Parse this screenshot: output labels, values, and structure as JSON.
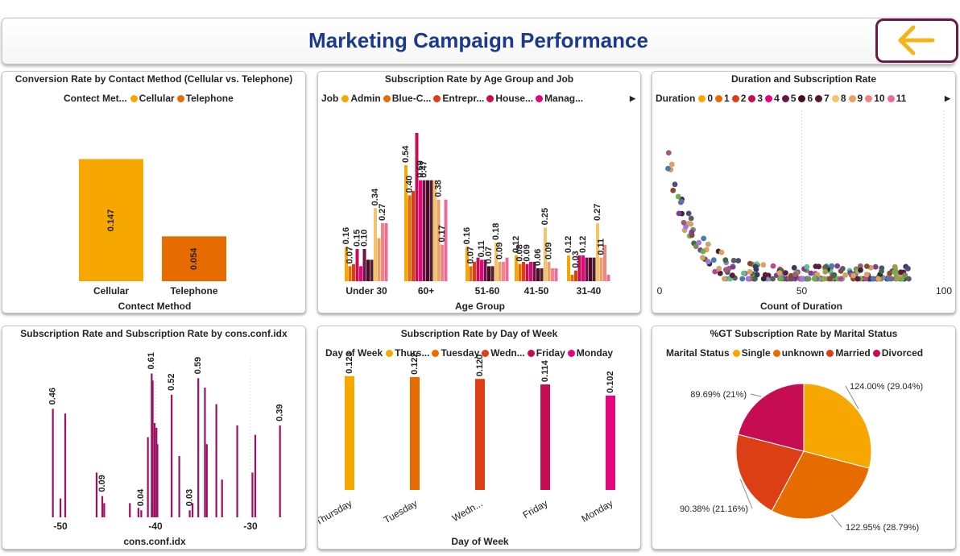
{
  "header": {
    "title": "Marketing Campaign Performance",
    "back_icon": "arrow-left-icon",
    "back_color": "#f4b41a"
  },
  "colors": {
    "palette": [
      "#f7a800",
      "#e66c00",
      "#dd3f14",
      "#c70d52",
      "#e3077e",
      "#6e1444",
      "#4b0a26",
      "#521f2e",
      "#f5c46a",
      "#e9a062",
      "#f28484",
      "#ea6b9c"
    ]
  },
  "panels": [
    {
      "key": "conv",
      "title": "Conversion Rate by Contact Method (Cellular vs. Telephone)",
      "legend": {
        "title": "Contect Met...",
        "items": [
          "Cellular",
          "Telephone"
        ]
      },
      "chart_data": {
        "type": "bar",
        "categories": [
          "Cellular",
          "Telephone"
        ],
        "values": [
          0.147,
          0.054
        ],
        "labels": [
          "0.147",
          "0.054"
        ],
        "xlabel": "Contect Method",
        "ylabel": "",
        "ylim": [
          0,
          0.16
        ]
      }
    },
    {
      "key": "agejob",
      "title": "Subscription Rate by Age Group and Job",
      "legend": {
        "title": "Job",
        "items": [
          "Admin",
          "Blue-C...",
          "Entrepr...",
          "House...",
          "Manag..."
        ]
      },
      "chart_data": {
        "type": "bar",
        "categories": [
          "Under 30",
          "60+",
          "51-60",
          "41-50",
          "31-40"
        ],
        "series": [
          {
            "name": "Admin",
            "values": [
              0.16,
              0.54,
              0.16,
              0.12,
              0.12
            ]
          },
          {
            "name": "Blue-C...",
            "values": [
              0.07,
              0.4,
              0.07,
              0.08,
              0.03
            ]
          },
          {
            "name": "Entrepr...",
            "values": [
              0.08,
              0.42,
              0.09,
              0.09,
              0.05
            ]
          },
          {
            "name": "House...",
            "values": [
              0.15,
              0.69,
              0.11,
              0.08,
              0.12
            ]
          },
          {
            "name": "Manag...",
            "values": [
              0.07,
              0.47,
              0.1,
              0.09,
              0.12
            ]
          },
          {
            "values": [
              0.15,
              0.47,
              0.1,
              0.09,
              0.11
            ]
          },
          {
            "values": [
              0.1,
              0.47,
              0.07,
              0.06,
              0.11
            ]
          },
          {
            "values": [
              0.1,
              0.47,
              0.07,
              0.06,
              0.11
            ]
          },
          {
            "values": [
              0.34,
              0.47,
              0.18,
              0.25,
              0.27
            ]
          },
          {
            "values": [
              0.2,
              0.38,
              0.09,
              0.09,
              0.11
            ]
          },
          {
            "values": [
              0.27,
              0.17,
              0.09,
              0.06,
              0.17
            ]
          },
          {
            "values": [
              0.27,
              0.38,
              0.11,
              0.06,
              0.03
            ]
          }
        ],
        "labels": [
          {
            "g": 0,
            "s": 0,
            "t": "0.16"
          },
          {
            "g": 0,
            "s": 1,
            "t": "0.07"
          },
          {
            "g": 0,
            "s": 3,
            "t": "0.15"
          },
          {
            "g": 0,
            "s": 5,
            "t": "0.10"
          },
          {
            "g": 0,
            "s": 8,
            "t": "0.34"
          },
          {
            "g": 0,
            "s": 10,
            "t": "0.27"
          },
          {
            "g": 1,
            "s": 0,
            "t": "0.54"
          },
          {
            "g": 1,
            "s": 1,
            "t": "0.40"
          },
          {
            "g": 1,
            "s": 4,
            "t": "0.69"
          },
          {
            "g": 1,
            "s": 5,
            "t": "0.47"
          },
          {
            "g": 1,
            "s": 9,
            "t": "0.38"
          },
          {
            "g": 1,
            "s": 10,
            "t": "0.17"
          },
          {
            "g": 2,
            "s": 0,
            "t": "0.16"
          },
          {
            "g": 2,
            "s": 1,
            "t": "0.07"
          },
          {
            "g": 2,
            "s": 4,
            "t": "0.11"
          },
          {
            "g": 2,
            "s": 6,
            "t": "0.07"
          },
          {
            "g": 2,
            "s": 8,
            "t": "0.18"
          },
          {
            "g": 2,
            "s": 9,
            "t": "0.09"
          },
          {
            "g": 3,
            "s": 0,
            "t": "0.12"
          },
          {
            "g": 3,
            "s": 1,
            "t": "0.08"
          },
          {
            "g": 3,
            "s": 3,
            "t": "0.09"
          },
          {
            "g": 3,
            "s": 6,
            "t": "0.06"
          },
          {
            "g": 3,
            "s": 8,
            "t": "0.25"
          },
          {
            "g": 3,
            "s": 9,
            "t": "0.09"
          },
          {
            "g": 4,
            "s": 0,
            "t": "0.12"
          },
          {
            "g": 4,
            "s": 2,
            "t": "0.03"
          },
          {
            "g": 4,
            "s": 4,
            "t": "0.12"
          },
          {
            "g": 4,
            "s": 8,
            "t": "0.27"
          },
          {
            "g": 4,
            "s": 9,
            "t": "0.11"
          }
        ],
        "xlabel": "Age Group",
        "ylabel": "",
        "ylim": [
          0,
          0.75
        ]
      }
    },
    {
      "key": "dur",
      "title": "Duration and Subscription Rate",
      "legend": {
        "title": "Duration",
        "items": [
          "0",
          "1",
          "2",
          "3",
          "4",
          "5",
          "6",
          "7",
          "8",
          "9",
          "10",
          "11"
        ]
      },
      "chart_data": {
        "type": "scatter",
        "xlabel": "Count of Duration",
        "ylabel": "",
        "xlim": [
          0,
          100
        ],
        "xticks": [
          "0",
          "50",
          "100"
        ]
      }
    },
    {
      "key": "cons",
      "title": "Subscription Rate and Subscription Rate by cons.conf.idx",
      "chart_data": {
        "type": "bar",
        "x": [
          -50.8,
          -50.0,
          -49.5,
          -46.2,
          -45.6,
          -45.4,
          -42.7,
          -41.8,
          -41.5,
          -40.8,
          -40.4,
          -40.3,
          -40.1,
          -39.9,
          -39.8,
          -38.3,
          -37.5,
          -36.4,
          -36.1,
          -35.5,
          -34.8,
          -34.6,
          -33.6,
          -33.0,
          -31.4,
          -29.8,
          -29.5,
          -26.9
        ],
        "values": [
          0.46,
          0.08,
          0.44,
          0.19,
          0.09,
          0.06,
          0.06,
          0.04,
          0.03,
          0.34,
          0.61,
          0.58,
          0.4,
          0.38,
          0.31,
          0.52,
          0.26,
          0.03,
          0.06,
          0.59,
          0.55,
          0.31,
          0.48,
          0.16,
          0.39,
          0.19,
          0.35,
          0.39
        ],
        "labels": [
          {
            "i": 0,
            "t": "0.46"
          },
          {
            "i": 4,
            "t": "0.09"
          },
          {
            "i": 8,
            "t": "0.04"
          },
          {
            "i": 10,
            "t": "0.61"
          },
          {
            "i": 15,
            "t": "0.52"
          },
          {
            "i": 17,
            "t": "0.03"
          },
          {
            "i": 19,
            "t": "0.59"
          },
          {
            "i": 27,
            "t": "0.39"
          }
        ],
        "color": "#9b1063",
        "xlabel": "cons.conf.idx",
        "ylabel": "",
        "xticks": [
          "-50",
          "-40",
          "-30"
        ],
        "ylim": [
          0,
          0.68
        ]
      }
    },
    {
      "key": "dow",
      "title": "Subscription Rate by Day of Week",
      "legend": {
        "title": "Day of Week",
        "items": [
          "Thurs...",
          "Tuesday",
          "Wedn...",
          "Friday",
          "Monday"
        ]
      },
      "chart_data": {
        "type": "bar",
        "categories": [
          "Thursday",
          "Tuesday",
          "Wedn...",
          "Friday",
          "Monday"
        ],
        "values": [
          0.123,
          0.122,
          0.12,
          0.114,
          0.102
        ],
        "labels": [
          "0.123",
          "0.122",
          "0.120",
          "0.114",
          "0.102"
        ],
        "xlabel": "Day of Week",
        "ylabel": "",
        "ylim": [
          0,
          0.135
        ]
      }
    },
    {
      "key": "marital",
      "title": "%GT Subscription Rate by Marital Status",
      "legend": {
        "title": "Marital Status",
        "items": [
          "Single",
          "unknown",
          "Married",
          "Divorced"
        ]
      },
      "chart_data": {
        "type": "pie",
        "categories": [
          "Single",
          "unknown",
          "Married",
          "Divorced"
        ],
        "values": [
          29.04,
          28.79,
          21.16,
          21.0
        ],
        "labels": [
          "124.00% (29.04%)",
          "122.95% (28.79%)",
          "90.38% (21.16%)",
          "89.69% (21%)"
        ]
      }
    }
  ]
}
